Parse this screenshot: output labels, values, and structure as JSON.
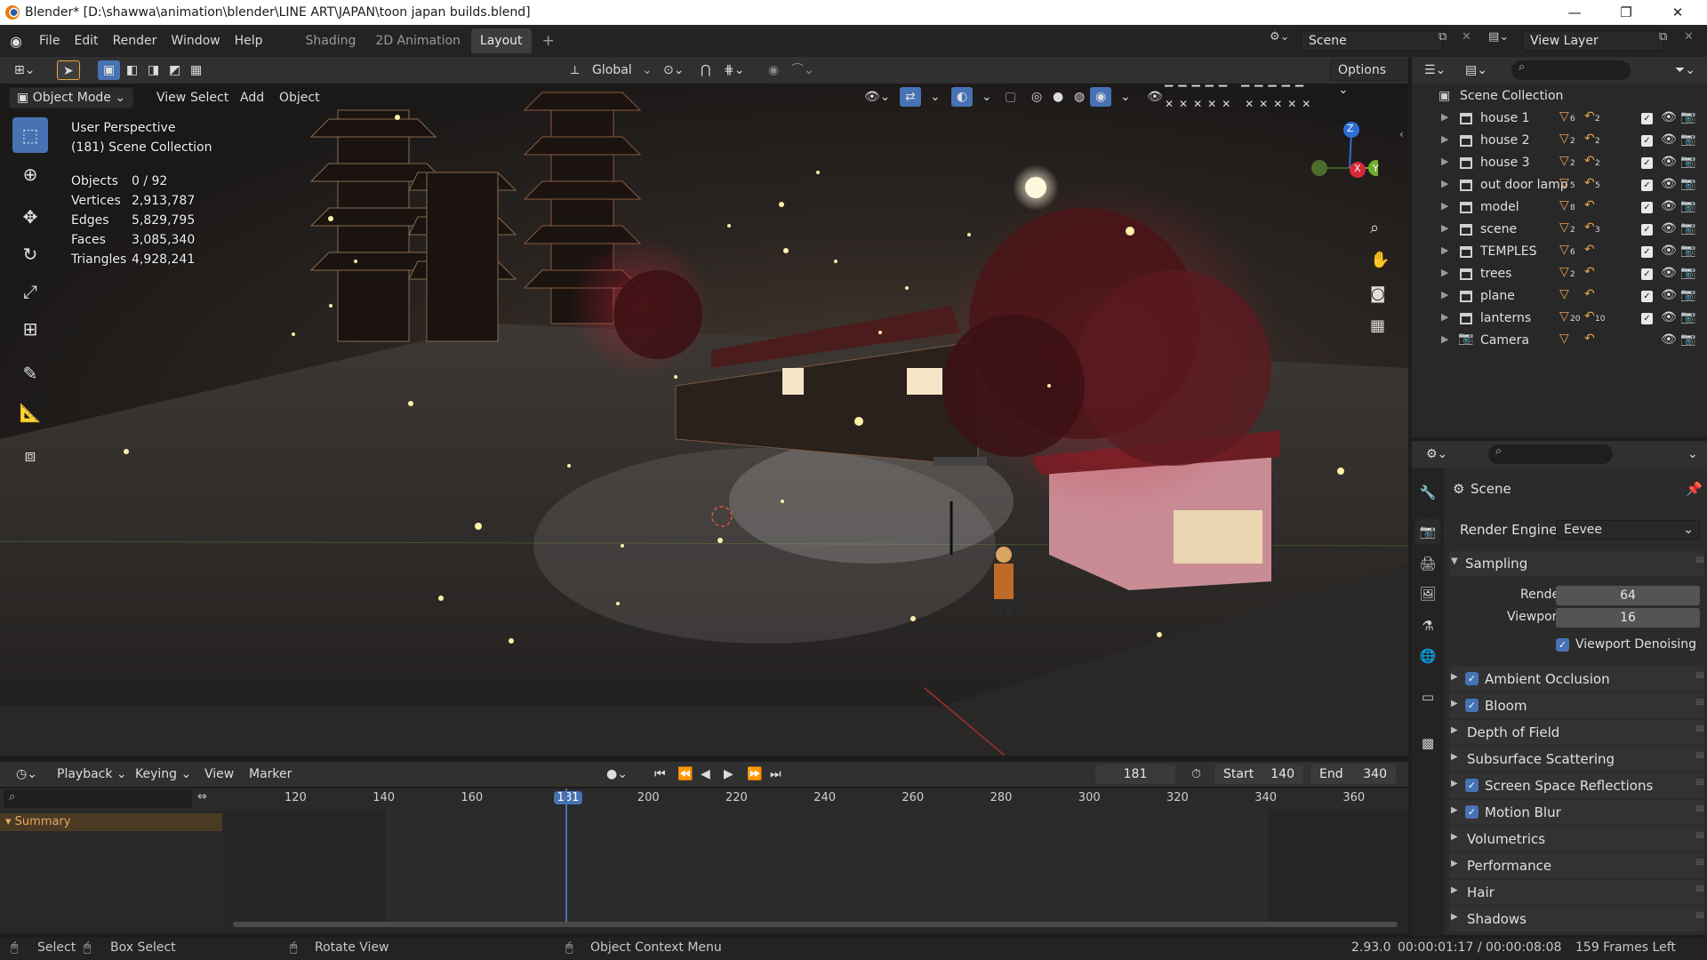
{
  "window": {
    "title": "Blender* [D:\\shawwa\\animation\\blender\\LINE ART\\JAPAN\\toon japan builds.blend]",
    "minimize": "—",
    "restore": "❐",
    "close": "✕"
  },
  "menubar": {
    "menus": [
      "File",
      "Edit",
      "Render",
      "Window",
      "Help"
    ],
    "workspaces": [
      "Shading",
      "2D Animation",
      "Layout"
    ],
    "active_workspace": "Layout",
    "add_tab": "+",
    "scene_name": "Scene",
    "view_layer_name": "View Layer"
  },
  "viewport_header": {
    "mode": "Object Mode",
    "menus": [
      "View",
      "Select",
      "Add",
      "Object"
    ],
    "orientation": "Global",
    "options": "Options"
  },
  "viewport": {
    "perspective": "User Perspective",
    "collection": "(181) Scene Collection",
    "stats": [
      {
        "label": "Objects",
        "value": "0 / 92"
      },
      {
        "label": "Vertices",
        "value": "2,913,787"
      },
      {
        "label": "Edges",
        "value": "5,829,795"
      },
      {
        "label": "Faces",
        "value": "3,085,340"
      },
      {
        "label": "Triangles",
        "value": "4,928,241"
      }
    ],
    "gizmo": {
      "z": "Z",
      "x": "X",
      "y": "Y"
    }
  },
  "timeline": {
    "menus": [
      "Playback",
      "Keying",
      "View",
      "Marker"
    ],
    "current_frame": "181",
    "start_label": "Start",
    "start": "140",
    "end_label": "End",
    "end": "340",
    "ticks": [
      "120",
      "140",
      "160",
      "181",
      "200",
      "220",
      "240",
      "260",
      "280",
      "300",
      "320",
      "340",
      "360"
    ],
    "summary": "Summary"
  },
  "statusbar": {
    "select": "Select",
    "box_select": "Box Select",
    "rotate_view": "Rotate View",
    "context_menu": "Object Context Menu",
    "info": "2.93.0",
    "time": "00:00:01:17 / 00:00:08:08",
    "frames_left": "159 Frames Left"
  },
  "outliner": {
    "root": "Scene Collection",
    "items": [
      {
        "name": "house 1",
        "c1": "6",
        "c2": "2"
      },
      {
        "name": "house 2",
        "c1": "2",
        "c2": "2"
      },
      {
        "name": "house 3",
        "c1": "2",
        "c2": "2"
      },
      {
        "name": "out door lamp",
        "c1": "5",
        "c2": "5"
      },
      {
        "name": "model",
        "c1": "8",
        "c2": ""
      },
      {
        "name": "scene",
        "c1": "2",
        "c2": "3"
      },
      {
        "name": "TEMPLES",
        "c1": "6",
        "c2": ""
      },
      {
        "name": "trees",
        "c1": "2",
        "c2": ""
      },
      {
        "name": "plane",
        "c1": "",
        "c2": ""
      },
      {
        "name": "lanterns",
        "c1": "20",
        "c2": "10"
      },
      {
        "name": "Camera",
        "c1": "",
        "c2": ""
      }
    ]
  },
  "properties": {
    "context": "Scene",
    "render_engine_label": "Render Engine",
    "render_engine": "Eevee",
    "sampling": "Sampling",
    "render_label": "Render",
    "render_samples": "64",
    "viewport_label": "Viewport",
    "viewport_samples": "16",
    "viewport_denoising": "Viewport Denoising",
    "panels": [
      {
        "label": "Ambient Occlusion",
        "checkbox": true
      },
      {
        "label": "Bloom",
        "checkbox": true
      },
      {
        "label": "Depth of Field",
        "checkbox": false
      },
      {
        "label": "Subsurface Scattering",
        "checkbox": false
      },
      {
        "label": "Screen Space Reflections",
        "checkbox": true
      },
      {
        "label": "Motion Blur",
        "checkbox": true
      },
      {
        "label": "Volumetrics",
        "checkbox": false
      },
      {
        "label": "Performance",
        "checkbox": false
      },
      {
        "label": "Hair",
        "checkbox": false
      },
      {
        "label": "Shadows",
        "checkbox": false
      }
    ]
  }
}
